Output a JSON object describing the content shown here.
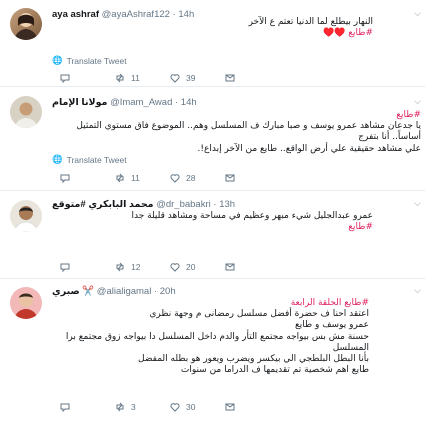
{
  "tweets": [
    {
      "name": "aya ashraf",
      "handle": "@ayaAshraf122",
      "time": "· 14h",
      "lines": [
        "النهار بيطلع لما الدنيا تعتم ع الآخر"
      ],
      "hashtag": "#طايع ♥️♥️",
      "translate": "Translate Tweet",
      "retweets": "11",
      "likes": "39",
      "replies": ""
    },
    {
      "name": "مولانا الإمام",
      "handle": "@Imam_Awad",
      "time": "· 14h",
      "hashtag_top": "#طايع",
      "lines": [
        "يا جدعان مشاهد عمرو يوسف و صبا مبارك ف المسلسل وهم.. الموضوع فاق مستوي التمثيل أساساً.. أنا بتفرج",
        "علي مشاهد حقيقية علي أرض الواقع.. طايع من الآخر إبداع!."
      ],
      "translate": "Translate Tweet",
      "replies": "",
      "retweets": "11",
      "likes": "28"
    },
    {
      "name": "محمد البابكري #متوقع",
      "handle": "@dr_babakri",
      "time": "· 13h",
      "lines": [
        "عمرو عبدالجليل شيء مبهر وعظيم في مساحة ومشاهد قليلة جدا"
      ],
      "hashtag": "#طايع",
      "replies": "",
      "retweets": "12",
      "likes": "20"
    },
    {
      "name": "صبري ✂️",
      "handle": "@alialigamal",
      "time": "· 20h",
      "lines": [
        "#طايع الحلقة الرابعة",
        "اعتقد احنا ف حضرة أفضل مسلسل رمضانى م وجهة نظري",
        "عمرو يوسف و طايع",
        "حسنة مش بس بيواجه مجتمع التأر والدم داخل المسلسل دا بيواجه زوق مجتمع برا المسلسل",
        "بأنا البطل البلطجي الي بيكسر ويضرب ويعور هو بطله المفضل",
        "طايع اهم شخصية تم تقديمها ف الدراما من سنوات"
      ],
      "replies": "",
      "retweets": "3",
      "likes": "30"
    }
  ],
  "colors": {
    "accent": "#1da1f2",
    "hashtag": "#e0245e",
    "muted": "#657786"
  }
}
